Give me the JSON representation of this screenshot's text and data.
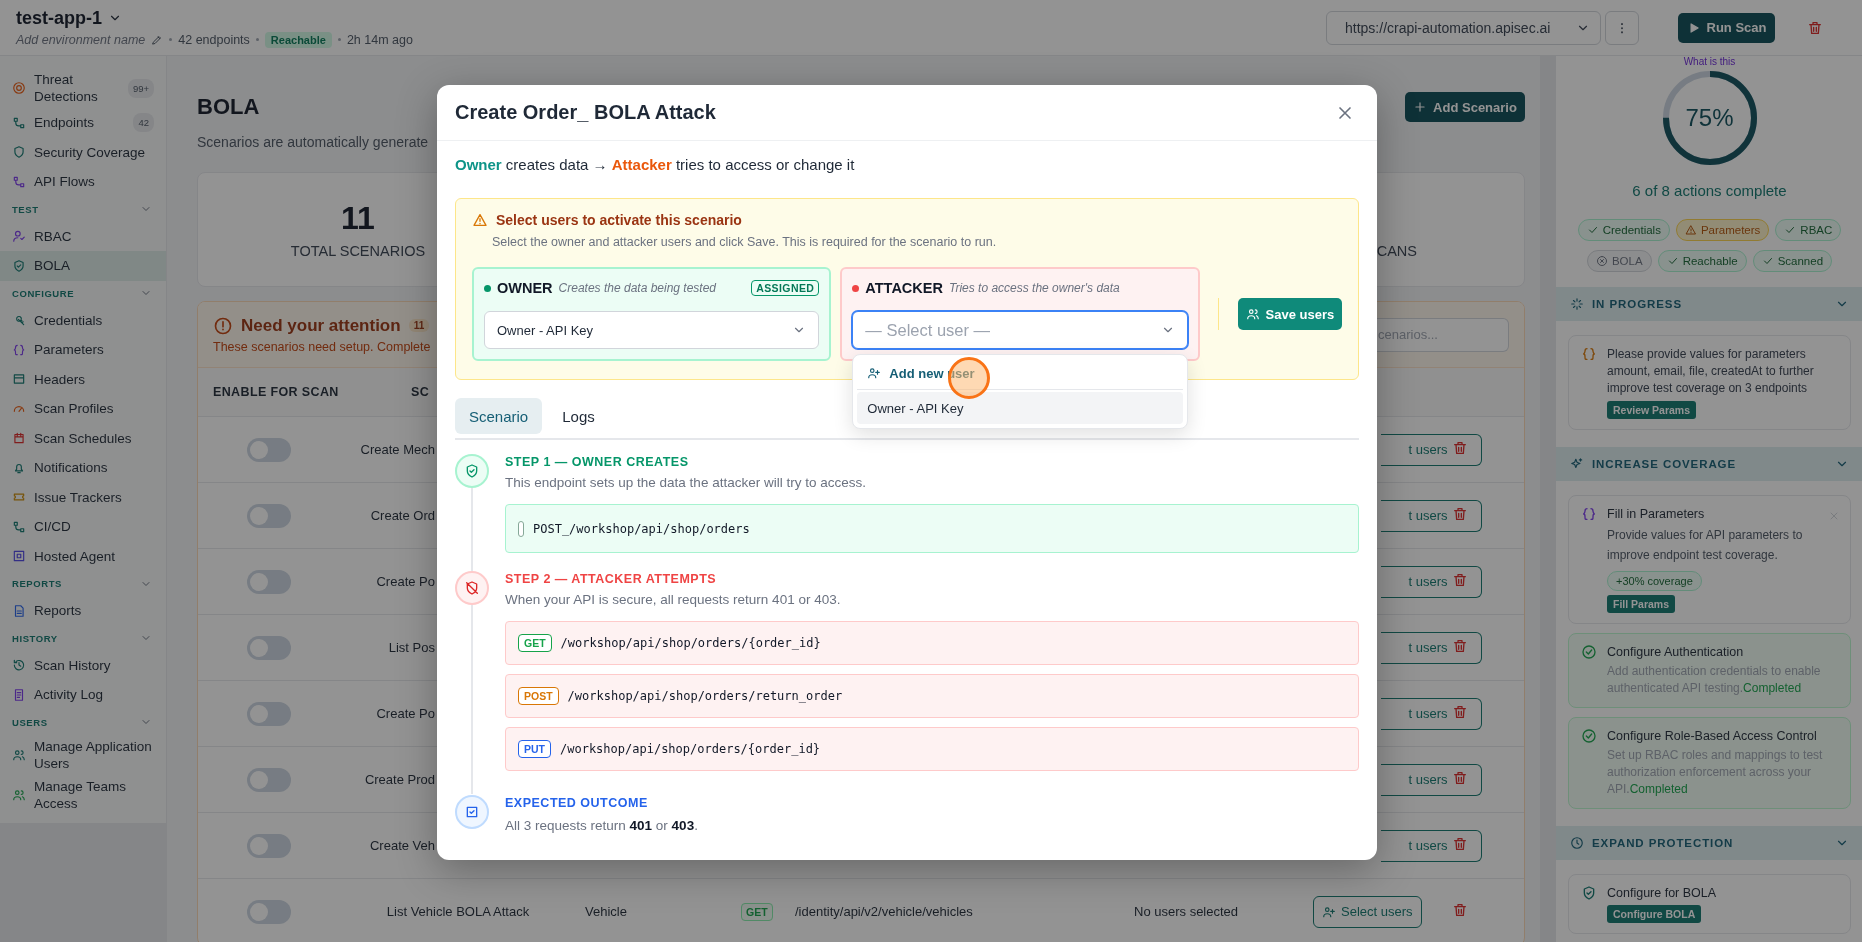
{
  "header": {
    "app_name": "test-app-1",
    "environment_placeholder": "Add environment name",
    "endpoints": "42 endpoints",
    "status": "Reachable",
    "last_scan": "2h 14m ago",
    "url": "https://crapi-automation.apisec.ai",
    "run_button": "Run Scan"
  },
  "sidebar": {
    "sections": [
      {
        "items": [
          {
            "label": "Threat Detections",
            "badge": "99+",
            "selected": false
          },
          {
            "label": "Endpoints",
            "badge": "42",
            "selected": false
          },
          {
            "label": "Security Coverage",
            "selected": false
          },
          {
            "label": "API Flows",
            "selected": false
          }
        ]
      },
      {
        "title": "TEST",
        "expanded": true,
        "items": [
          {
            "label": "RBAC",
            "selected": false
          },
          {
            "label": "BOLA",
            "selected": true
          }
        ]
      },
      {
        "title": "CONFIGURE",
        "expanded": true,
        "items": [
          {
            "label": "Credentials",
            "selected": false
          },
          {
            "label": "Parameters",
            "selected": false
          },
          {
            "label": "Headers",
            "selected": false
          },
          {
            "label": "Scan Profiles",
            "selected": false
          },
          {
            "label": "Scan Schedules",
            "selected": false
          },
          {
            "label": "Notifications",
            "selected": false
          },
          {
            "label": "Issue Trackers",
            "selected": false
          },
          {
            "label": "CI/CD",
            "selected": false
          },
          {
            "label": "Hosted Agent",
            "selected": false
          }
        ]
      },
      {
        "title": "REPORTS",
        "expanded": true,
        "items": [
          {
            "label": "Reports",
            "selected": false
          }
        ]
      },
      {
        "title": "HISTORY",
        "expanded": true,
        "items": [
          {
            "label": "Scan History",
            "selected": false
          },
          {
            "label": "Activity Log",
            "selected": false
          }
        ]
      },
      {
        "title": "USERS",
        "expanded": true,
        "items": [
          {
            "label": "Manage Application Users",
            "selected": false
          },
          {
            "label": "Manage Teams Access",
            "selected": false
          }
        ]
      }
    ]
  },
  "main": {
    "title": "BOLA",
    "subtitle": "Scenarios are automatically generate",
    "add_button": "Add Scenario",
    "stats": [
      {
        "value": "11",
        "label": "TOTAL SCENARIOS"
      },
      {
        "label": "CANS"
      }
    ],
    "attention": {
      "title": "Need your attention",
      "count": "11",
      "subtitle": "These scenarios need setup. Complete",
      "search_placeholder": "cenarios...",
      "columns": [
        "ENABLE FOR SCAN",
        "SC"
      ],
      "rows": [
        {
          "kind": "partial",
          "enabled": false,
          "scenario": "Create Mech",
          "action": "t users"
        },
        {
          "kind": "partial",
          "enabled": false,
          "scenario": "Create Ord",
          "action": "t users"
        },
        {
          "kind": "partial",
          "enabled": false,
          "scenario": "Create Po",
          "action": "t users"
        },
        {
          "kind": "partial",
          "enabled": false,
          "scenario": "List Pos",
          "action": "t users"
        },
        {
          "kind": "partial",
          "enabled": false,
          "scenario": "Create Po",
          "action": "t users"
        },
        {
          "kind": "partial",
          "enabled": false,
          "scenario": "Create Prod",
          "action": "t users"
        },
        {
          "kind": "partial",
          "enabled": false,
          "scenario": "Create Veh",
          "action": "t users"
        },
        {
          "kind": "full",
          "enabled": false,
          "scenario": "List Vehicle BOLA Attack",
          "resource": "Vehicle",
          "method": "GET",
          "endpoint": "/identity/api/v2/vehicle/vehicles",
          "status": "No users selected",
          "action": "Select users"
        }
      ]
    }
  },
  "right_panel": {
    "help_link": "What is this",
    "progress": {
      "level": 0.75,
      "value": "75%",
      "caption": "6 of 8 actions complete"
    },
    "chips": [
      {
        "label": "Credentials",
        "kind": "done"
      },
      {
        "label": "Parameters",
        "kind": "warning"
      },
      {
        "label": "RBAC",
        "kind": "done"
      },
      {
        "label": "BOLA",
        "kind": "failed"
      },
      {
        "label": "Reachable",
        "kind": "done"
      },
      {
        "label": "Scanned",
        "kind": "done"
      }
    ],
    "sections": [
      {
        "title": "IN PROGRESS",
        "expanded": true,
        "cards": [
          {
            "kind": "pending",
            "text": "Please provide values for parameters amount, email, file, createdAt to further improve test coverage on 3 endpoints",
            "button": "Review Params"
          }
        ]
      },
      {
        "title": "INCREASE COVERAGE",
        "expanded": true,
        "cards": [
          {
            "kind": "suggestion",
            "title": "Fill in Parameters",
            "text": "Provide values for API parameters to improve endpoint test coverage.",
            "badge": "+30% coverage",
            "button": "Fill Params"
          },
          {
            "kind": "completed",
            "title": "Configure Authentication",
            "text": "Add authentication credentials to enable authenticated API testing.",
            "status": "Completed"
          },
          {
            "kind": "completed",
            "title": "Configure Role-Based Access Control",
            "text": "Set up RBAC roles and mappings to test authorization enforcement across your API.",
            "status": "Completed"
          }
        ]
      },
      {
        "title": "EXPAND PROTECTION",
        "expanded": true,
        "cards": [
          {
            "kind": "protect",
            "title": "Configure for BOLA",
            "button": "Configure BOLA"
          }
        ]
      }
    ]
  },
  "modal": {
    "title": "Create Order_ BOLA Attack",
    "flow": {
      "owner": "Owner",
      "owner_text": "creates data →",
      "attacker": "Attacker",
      "attacker_text": "tries to access or change it"
    },
    "notice": {
      "title": "Select users to activate this scenario",
      "text": "Select the owner and attacker users and click Save. This is required for the scenario to run."
    },
    "roles": [
      {
        "kind": "owner",
        "name": "OWNER",
        "description": "Creates the data being tested",
        "badge": "ASSIGNED",
        "value": "Owner - API Key",
        "focused": false
      },
      {
        "kind": "attacker",
        "name": "ATTACKER",
        "description": "Tries to access the owner's data",
        "placeholder": "— Select user —",
        "focused": true,
        "dropdown": {
          "add_label": "Add new user",
          "options": [
            {
              "label": "Owner - API Key",
              "highlighted": true
            }
          ]
        }
      }
    ],
    "save_button": "Save users",
    "tabs": [
      {
        "label": "Scenario",
        "selected": true
      },
      {
        "label": "Logs",
        "selected": false
      }
    ],
    "steps": [
      {
        "kind": "owner",
        "title": "STEP 1 — OWNER CREATES",
        "text": "This endpoint sets up the data the attacker will try to access.",
        "requests": [
          {
            "path": "POST_/workshop/api/shop/orders"
          }
        ]
      },
      {
        "kind": "attacker",
        "title": "STEP 2 — ATTACKER ATTEMPTS",
        "text": "When your API is secure, all requests return 401 or 403.",
        "requests": [
          {
            "method": "GET",
            "color": "#16a34a",
            "path": "/workshop/api/shop/orders/{order_id}"
          },
          {
            "method": "POST",
            "color": "#d97706",
            "path": "/workshop/api/shop/orders/return_order"
          },
          {
            "method": "PUT",
            "color": "#2563eb",
            "path": "/workshop/api/shop/orders/{order_id}"
          }
        ]
      },
      {
        "kind": "outcome",
        "title": "EXPECTED OUTCOME",
        "text": "All 3 requests return **401** or **403**."
      }
    ]
  }
}
